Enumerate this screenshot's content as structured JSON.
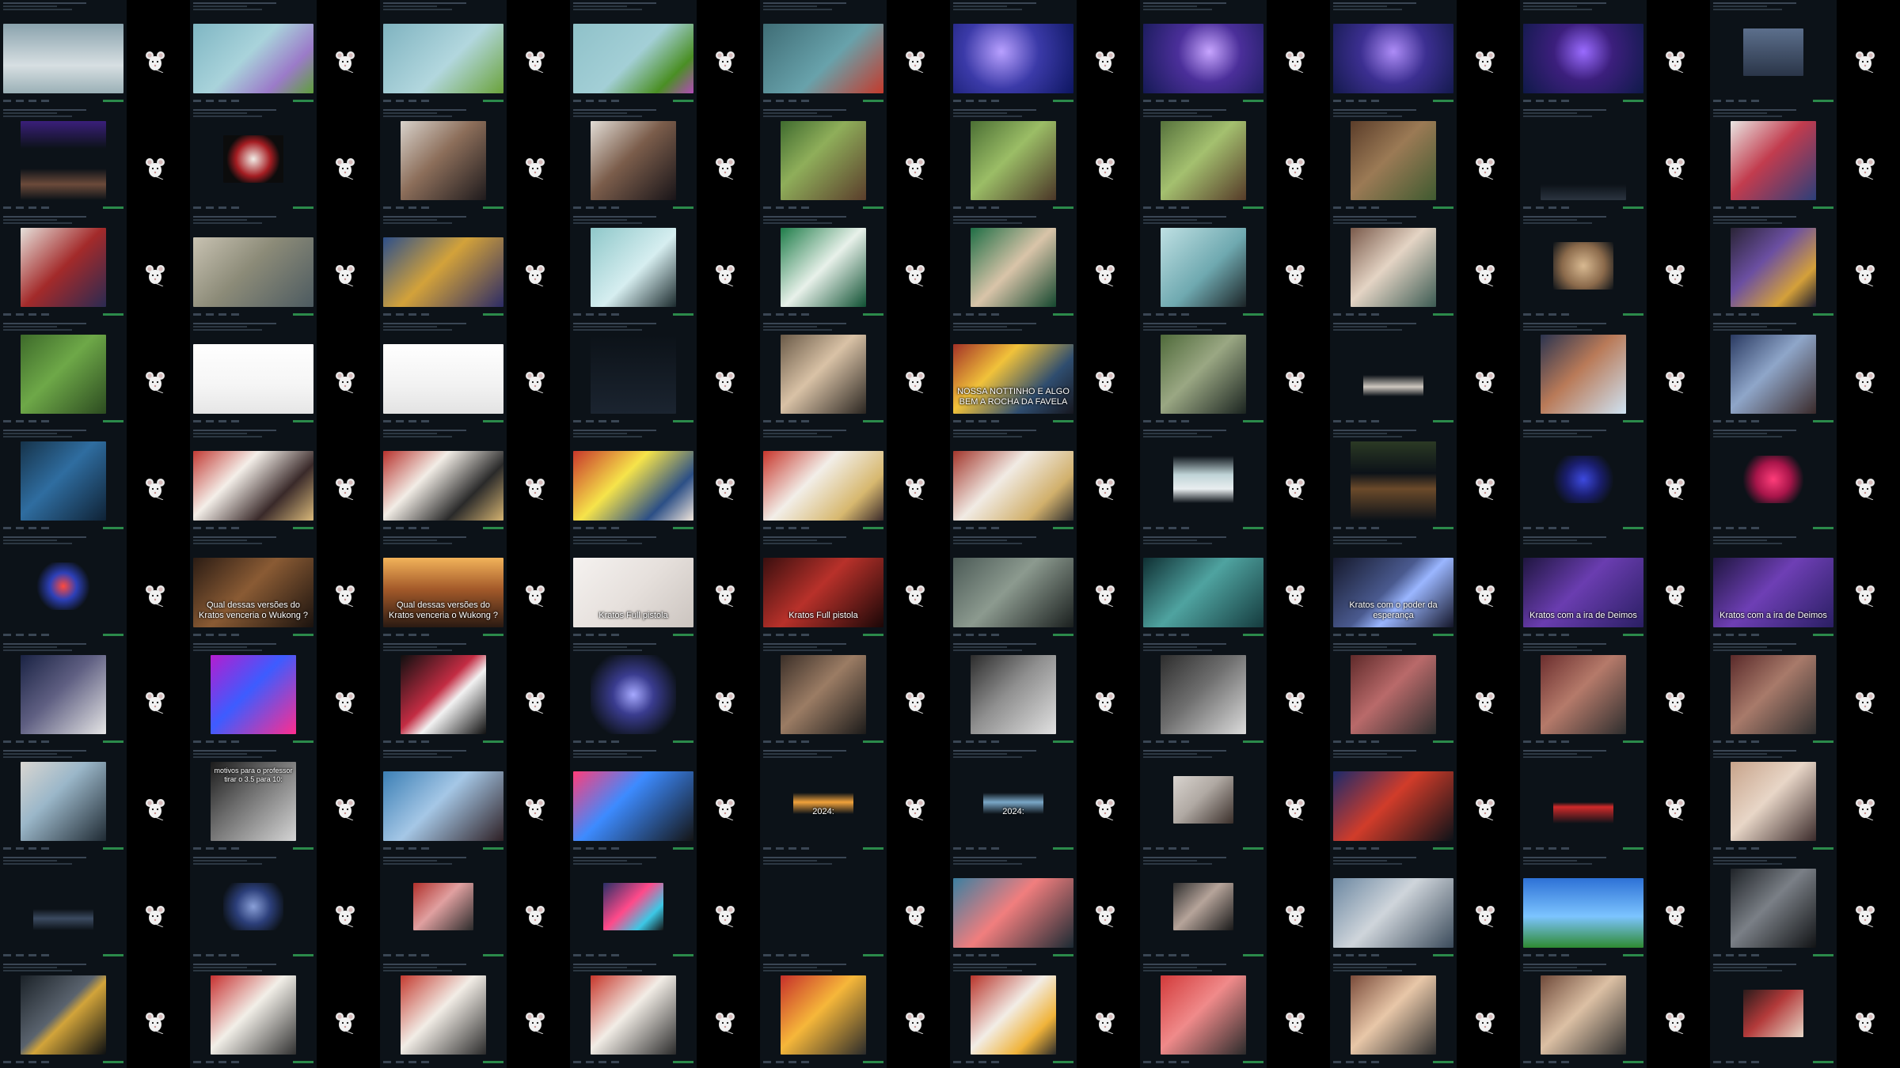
{
  "window": {
    "title": ""
  },
  "tiles": [
    {
      "bg": "linear-gradient(180deg,#8aa3ad 0%,#d7dfe2 60%,#9ab0b6 100%)",
      "caption": "",
      "kind": "wide"
    },
    {
      "bg": "linear-gradient(135deg,#7fb6c3 0%,#a9d3db 45%,#9b7bc9 75%,#5e9f3a 100%)",
      "caption": "",
      "kind": "wide"
    },
    {
      "bg": "linear-gradient(135deg,#7fb3c0 0%,#b2d7de 55%,#6aa23a 100%)",
      "caption": "",
      "kind": "wide"
    },
    {
      "bg": "linear-gradient(135deg,#8fc1c9 0%,#a3cfd6 50%,#4a8f24 80%,#b24ab7 100%)",
      "caption": "",
      "kind": "wide"
    },
    {
      "bg": "linear-gradient(135deg,#3f6d76 0%,#68a2ab 55%,#c43a2c 100%)",
      "caption": "",
      "kind": "wide"
    },
    {
      "bg": "radial-gradient(circle at 40% 40%,#b8a0ff 0%,#3b3aa8 45%,#0d1660 100%)",
      "caption": "",
      "kind": "wide"
    },
    {
      "bg": "radial-gradient(circle at 55% 40%,#c7a5ff 0%,#4b2f9a 40%,#151a55 100%)",
      "caption": "",
      "kind": "wide"
    },
    {
      "bg": "radial-gradient(circle at 50% 40%,#ad8cf7 0%,#3c2f91 45%,#141a4d 100%)",
      "caption": "",
      "kind": "wide"
    },
    {
      "bg": "radial-gradient(circle at 50% 40%,#9a6bff 0%,#3c1f7d 40%,#0f1a49 100%)",
      "caption": "",
      "kind": "wide"
    },
    {
      "bg": "linear-gradient(180deg,#5c6f8c 0%,#2a3548 100%)",
      "caption": "",
      "kind": "small"
    },
    {
      "bg": "linear-gradient(180deg,#3a1f7a 0%,#0c1218 35%,#0c1218 60%,#6b4a3a 80%,#0c1218 100%)",
      "caption": "",
      "kind": "full"
    },
    {
      "bg": "radial-gradient(circle at 50% 50%,#f2eee8 0%,#a41d22 45%,#0c0c0c 70%)",
      "caption": "",
      "kind": "small"
    },
    {
      "bg": "linear-gradient(135deg,#d8d2cb 0%,#8c6e5a 45%,#1e1a1c 100%)",
      "caption": "",
      "kind": "full"
    },
    {
      "bg": "linear-gradient(135deg,#e2ddd6 0%,#7b5d4b 45%,#181418 100%)",
      "caption": "",
      "kind": "full"
    },
    {
      "bg": "linear-gradient(135deg,#3f6b2f 0%,#8fae5a 40%,#5a3d2b 100%)",
      "caption": "",
      "kind": "full"
    },
    {
      "bg": "linear-gradient(135deg,#4b6f34 0%,#9bbd66 45%,#4a3527 100%)",
      "caption": "",
      "kind": "full"
    },
    {
      "bg": "linear-gradient(135deg,#56723c 0%,#a4c06f 45%,#553a28 100%)",
      "caption": "",
      "kind": "full"
    },
    {
      "bg": "linear-gradient(135deg,#5b3d2a 0%,#9b7a55 45%,#3f5a30 100%)",
      "caption": "",
      "kind": "full"
    },
    {
      "bg": "linear-gradient(180deg,#0c1218 0%,#0c1218 80%,#2b3440 100%)",
      "caption": "",
      "kind": "full"
    },
    {
      "bg": "linear-gradient(135deg,#e9e6e3 0%,#c23c4e 45%,#2b3f7a 100%)",
      "caption": "",
      "kind": "full"
    },
    {
      "bg": "linear-gradient(135deg,#e6e1db 0%,#a32a2a 50%,#2a2a52 100%)",
      "caption": "",
      "kind": "full"
    },
    {
      "bg": "linear-gradient(135deg,#c8c2b2 0%,#8c8b78 45%,#4c5a60 100%)",
      "caption": "",
      "kind": "wide"
    },
    {
      "bg": "linear-gradient(135deg,#2d4f8a 0%,#d3a23a 45%,#2b2b66 100%)",
      "caption": "",
      "kind": "wide"
    },
    {
      "bg": "linear-gradient(135deg,#8ec7c9 0%,#d6eef0 55%,#1b2a2d 100%)",
      "caption": "",
      "kind": "full"
    },
    {
      "bg": "linear-gradient(135deg,#1f7d4a 0%,#e8f1ea 50%,#0f5032 100%)",
      "caption": "",
      "kind": "full"
    },
    {
      "bg": "linear-gradient(135deg,#1f6e45 0%,#d9c4a9 50%,#14472e 100%)",
      "caption": "",
      "kind": "full"
    },
    {
      "bg": "linear-gradient(135deg,#bfe0e3 0%,#6fa9b0 55%,#1b2326 100%)",
      "caption": "",
      "kind": "full"
    },
    {
      "bg": "linear-gradient(135deg,#7a5a4b 0%,#e4d4c4 45%,#3b5a52 100%)",
      "caption": "",
      "kind": "full"
    },
    {
      "bg": "radial-gradient(circle at 50% 50%,#d8b991 0%,#8b6a4b 55%,#0c1218 100%)",
      "caption": "",
      "kind": "small"
    },
    {
      "bg": "linear-gradient(135deg,#2a2436 0%,#6b4fa1 40%,#d4a03a 75%,#1b1b2e 100%)",
      "caption": "",
      "kind": "full"
    },
    {
      "bg": "linear-gradient(135deg,#3d6a2a 0%,#6ea848 45%,#2c4b20 100%)",
      "caption": "",
      "kind": "full"
    },
    {
      "bg": "linear-gradient(180deg,#ffffff 0%,#f5f5f5 60%,#e6e6e6 100%)",
      "caption": "",
      "kind": "wide"
    },
    {
      "bg": "linear-gradient(180deg,#ffffff 0%,#f2f2f2 60%,#e3e3e3 100%)",
      "caption": "",
      "kind": "wide"
    },
    {
      "bg": "linear-gradient(180deg,#0c1218 0%,#1b2430 100%)",
      "caption": "",
      "kind": "full"
    },
    {
      "bg": "linear-gradient(135deg,#6a5a48 0%,#d9c2a6 45%,#2b2621 100%)",
      "caption": "",
      "kind": "full"
    },
    {
      "bg": "linear-gradient(135deg,#a33127 0%,#f1c23a 35%,#2f4d6f 70%,#16171f 100%)",
      "caption": "NOSSA NOTTINHO E ALGO BEM A ROCHA DA FAVELA",
      "kind": "wide"
    },
    {
      "bg": "linear-gradient(135deg,#4f6a3a 0%,#9aa783 45%,#1b2420 100%)",
      "caption": "",
      "kind": "full"
    },
    {
      "bg": "linear-gradient(180deg,#0c1218 0%,#0c1218 55%,#cfc8c0 80%,#0c1218 100%)",
      "caption": "",
      "kind": "small"
    },
    {
      "bg": "linear-gradient(135deg,#2b3450 0%,#b97a58 45%,#cfe3f3 100%)",
      "caption": "",
      "kind": "full"
    },
    {
      "bg": "linear-gradient(135deg,#2a3a62 0%,#8fa6c9 45%,#3a2a2a 100%)",
      "caption": "",
      "kind": "full"
    },
    {
      "bg": "linear-gradient(135deg,#16334a 0%,#2f6da0 45%,#0f2235 100%)",
      "caption": "",
      "kind": "full"
    },
    {
      "bg": "linear-gradient(135deg,#c23b35 0%,#f4efe9 35%,#3a2a2a 70%,#d9b97a 100%)",
      "caption": "",
      "kind": "wide"
    },
    {
      "bg": "linear-gradient(135deg,#b7322d 0%,#f2ede6 35%,#2a2a2a 70%,#d4b371 100%)",
      "caption": "",
      "kind": "wide"
    },
    {
      "bg": "linear-gradient(135deg,#c7372b 0%,#f6e44a 40%,#2c4f86 75%,#f1e6dc 100%)",
      "caption": "",
      "kind": "wide"
    },
    {
      "bg": "linear-gradient(135deg,#c7362c 0%,#f2eee8 40%,#d7b86f 75%,#3a2a2a 100%)",
      "caption": "",
      "kind": "wide"
    },
    {
      "bg": "linear-gradient(135deg,#a2362c 0%,#f1ebe4 40%,#d1b06c 75%,#2e2e2e 100%)",
      "caption": "",
      "kind": "wide"
    },
    {
      "bg": "linear-gradient(180deg,#0c1218 0%,#bfd3d6 40%,#e9eef0 70%,#0c1218 100%)",
      "caption": "",
      "kind": "small"
    },
    {
      "bg": "linear-gradient(180deg,#2b3a24 0%,#0c1218 40%,#6b4a2a 60%,#0c1218 100%)",
      "caption": "",
      "kind": "full"
    },
    {
      "bg": "radial-gradient(circle at 50% 50%,#3d4ae0 0%,#1a1e6e 45%,#0c1218 80%)",
      "caption": "",
      "kind": "small"
    },
    {
      "bg": "radial-gradient(circle at 50% 50%,#ff3d7a 0%,#a8154a 45%,#0c1218 80%)",
      "caption": "",
      "kind": "small"
    },
    {
      "bg": "radial-gradient(circle at 50% 50%,#ff4a3d 0%,#2d40b8 35%,#0c1218 70%)",
      "caption": "",
      "kind": "small"
    },
    {
      "bg": "linear-gradient(135deg,#2b1c14 0%,#8a5b34 45%,#1a120e 100%)",
      "caption": "Qual dessas versões do Kratos venceria o Wukong ?",
      "kind": "wide"
    },
    {
      "bg": "linear-gradient(180deg,#f2b35a 0%,#a45a2a 45%,#2a1a12 100%)",
      "caption": "Qual dessas versões do Kratos venceria o Wukong ?",
      "kind": "wide"
    },
    {
      "bg": "linear-gradient(135deg,#f5f2f0 0%,#e6e0dc 50%,#cbc4bf 100%)",
      "caption": "Kratos Full pistola",
      "kind": "wide"
    },
    {
      "bg": "linear-gradient(135deg,#3a0f0f 0%,#b8312a 45%,#1a0707 100%)",
      "caption": "Kratos Full pistola",
      "kind": "wide"
    },
    {
      "bg": "linear-gradient(135deg,#4b5a56 0%,#8c9a8f 45%,#1a1f1e 100%)",
      "caption": "",
      "kind": "wide"
    },
    {
      "bg": "linear-gradient(135deg,#0f2f33 0%,#4fa3a0 45%,#153b3e 100%)",
      "caption": "",
      "kind": "wide"
    },
    {
      "bg": "linear-gradient(135deg,#15192c 0%,#4a5a8f 45%,#9ab6ff 60%,#141629 100%)",
      "caption": "Kratos com o poder da esperança",
      "kind": "wide"
    },
    {
      "bg": "linear-gradient(135deg,#1f1640 0%,#6a3db0 45%,#2a1f63 100%)",
      "caption": "Kratos com a ira de Deimos",
      "kind": "wide"
    },
    {
      "bg": "linear-gradient(135deg,#1f1640 0%,#6e3fb5 45%,#2a1f63 100%)",
      "caption": "Kratos com a ira de Deimos",
      "kind": "wide"
    },
    {
      "bg": "linear-gradient(135deg,#1a2344 0%,#5f5f82 45%,#e6e6e6 100%)",
      "caption": "",
      "kind": "full"
    },
    {
      "bg": "linear-gradient(135deg,#b41dcf 0%,#3d5cff 45%,#ff2d8e 100%)",
      "caption": "",
      "kind": "full"
    },
    {
      "bg": "linear-gradient(135deg,#101010 0%,#c32c43 45%,#f2f2f2 60%,#101010 100%)",
      "caption": "",
      "kind": "full"
    },
    {
      "bg": "radial-gradient(circle at 50% 50%,#a6a9ff 0%,#3a3c8f 35%,#0c1218 80%)",
      "caption": "",
      "kind": "full"
    },
    {
      "bg": "linear-gradient(135deg,#3b2f28 0%,#9b7c64 45%,#1c1b1a 100%)",
      "caption": "",
      "kind": "full"
    },
    {
      "bg": "linear-gradient(135deg,#2c2c2c 0%,#8e8e8e 45%,#e1e1e1 100%)",
      "caption": "",
      "kind": "full"
    },
    {
      "bg": "linear-gradient(135deg,#2d2d2d 0%,#6e6e6e 45%,#dcdcdc 100%)",
      "caption": "",
      "kind": "full"
    },
    {
      "bg": "linear-gradient(135deg,#5f2a2a 0%,#b96a6a 45%,#2e2e2e 100%)",
      "caption": "",
      "kind": "full"
    },
    {
      "bg": "linear-gradient(135deg,#6b2e2e 0%,#b57a6a 45%,#2e2e2e 100%)",
      "caption": "",
      "kind": "full"
    },
    {
      "bg": "linear-gradient(135deg,#5a2a2a 0%,#a87a6a 45%,#2e2e2e 100%)",
      "caption": "",
      "kind": "full"
    },
    {
      "bg": "linear-gradient(135deg,#d9d6d1 0%,#9bb7c9 40%,#1f2a33 100%)",
      "caption": "",
      "kind": "full"
    },
    {
      "bg": "linear-gradient(135deg,#1b1b1b 0%,#6a6a6a 40%,#d5d5d5 100%)",
      "caption": "motivos para o professor tirar o 3.5 para 10:",
      "kind": "full"
    },
    {
      "bg": "linear-gradient(135deg,#3b7fb5 0%,#a5c7e6 45%,#2d1f24 100%)",
      "caption": "",
      "kind": "wide"
    },
    {
      "bg": "linear-gradient(135deg,#ff3d7a 0%,#3d8bff 40%,#141414 100%)",
      "caption": "",
      "kind": "wide"
    },
    {
      "bg": "linear-gradient(180deg,#0c1218 0%,#0c1218 35%,#f1a23b 55%,#0c1218 80%)",
      "caption": "2024:",
      "kind": "small"
    },
    {
      "bg": "linear-gradient(180deg,#0c1218 0%,#0c1218 35%,#7aa7c7 55%,#0c1218 80%)",
      "caption": "2024:",
      "kind": "small"
    },
    {
      "bg": "linear-gradient(135deg,#d9d4cf 0%,#b0a9a3 45%,#3a2f2a 100%)",
      "caption": "",
      "kind": "small"
    },
    {
      "bg": "linear-gradient(135deg,#1b2a6b 0%,#d13c2a 45%,#0c1218 100%)",
      "caption": "",
      "kind": "wide"
    },
    {
      "bg": "linear-gradient(180deg,#0c1218 0%,#0c1218 55%,#d12a2a 65%,#0c1218 100%)",
      "caption": "",
      "kind": "small"
    },
    {
      "bg": "linear-gradient(135deg,#c7a38a 0%,#e8d6c7 45%,#3a2a2a 100%)",
      "caption": "",
      "kind": "full"
    },
    {
      "bg": "linear-gradient(180deg,#0c1218 0%,#0c1218 55%,#3b4a60 75%,#0c1218 100%)",
      "caption": "",
      "kind": "small"
    },
    {
      "bg": "radial-gradient(circle at 50% 50%,#8aa0d8 0%,#2c3f7a 45%,#0c1218 85%)",
      "caption": "",
      "kind": "small"
    },
    {
      "bg": "linear-gradient(135deg,#b0302b 0%,#e0a0a0 45%,#2b2b2b 100%)",
      "caption": "",
      "kind": "small"
    },
    {
      "bg": "linear-gradient(135deg,#2a2f66 0%,#ff4a8a 45%,#3cc8e6 75%,#141414 100%)",
      "caption": "",
      "kind": "small"
    },
    {
      "bg": "linear-gradient(180deg,#0c1218 0%,#0c1218 100%)",
      "caption": "",
      "kind": "full"
    },
    {
      "bg": "linear-gradient(135deg,#3b7fa1 0%,#f17e7e 45%,#1b2a33 100%)",
      "caption": "",
      "kind": "wide"
    },
    {
      "bg": "linear-gradient(135deg,#2d2d2d 0%,#b6a49a 45%,#191919 100%)",
      "caption": "",
      "kind": "small"
    },
    {
      "bg": "linear-gradient(135deg,#6b87a1 0%,#cfd5db 45%,#3a4a5a 100%)",
      "caption": "",
      "kind": "wide"
    },
    {
      "bg": "linear-gradient(180deg,#2d71d6 0%,#7cc4ff 55%,#2e8a31 100%)",
      "caption": "",
      "kind": "wide"
    },
    {
      "bg": "linear-gradient(135deg,#1f2328 0%,#7a7f86 45%,#111315 100%)",
      "caption": "",
      "kind": "full"
    },
    {
      "bg": "linear-gradient(135deg,#1b2228 0%,#5a636e 45%,#d2a43a 55%,#0c0f12 100%)",
      "caption": "",
      "kind": "full"
    },
    {
      "bg": "linear-gradient(135deg,#c73131 0%,#f2efe8 45%,#313131 100%)",
      "caption": "",
      "kind": "full"
    },
    {
      "bg": "linear-gradient(135deg,#c43b30 0%,#f2ede6 45%,#2b2b2b 100%)",
      "caption": "",
      "kind": "full"
    },
    {
      "bg": "linear-gradient(135deg,#c7372b 0%,#f2ede6 45%,#2b2b2b 100%)",
      "caption": "",
      "kind": "full"
    },
    {
      "bg": "linear-gradient(135deg,#c62f2a 0%,#f6b73a 45%,#2b2b2b 100%)",
      "caption": "",
      "kind": "full"
    },
    {
      "bg": "linear-gradient(135deg,#b8342b 0%,#f2ede6 45%,#f0b33a 75%,#2b2b2b 100%)",
      "caption": "",
      "kind": "full"
    },
    {
      "bg": "linear-gradient(135deg,#d23a3a 0%,#f08a8a 45%,#2b2b2b 100%)",
      "caption": "",
      "kind": "full"
    },
    {
      "bg": "linear-gradient(135deg,#7a4b3a 0%,#e8c7a8 45%,#2d2d2d 100%)",
      "caption": "",
      "kind": "full"
    },
    {
      "bg": "linear-gradient(135deg,#6f4a3a 0%,#dcc0a4 45%,#2d2d2d 100%)",
      "caption": "",
      "kind": "full"
    },
    {
      "bg": "linear-gradient(135deg,#2a1b1b 0%,#b33a3a 45%,#e7d7c8 100%)",
      "caption": "",
      "kind": "small"
    }
  ]
}
